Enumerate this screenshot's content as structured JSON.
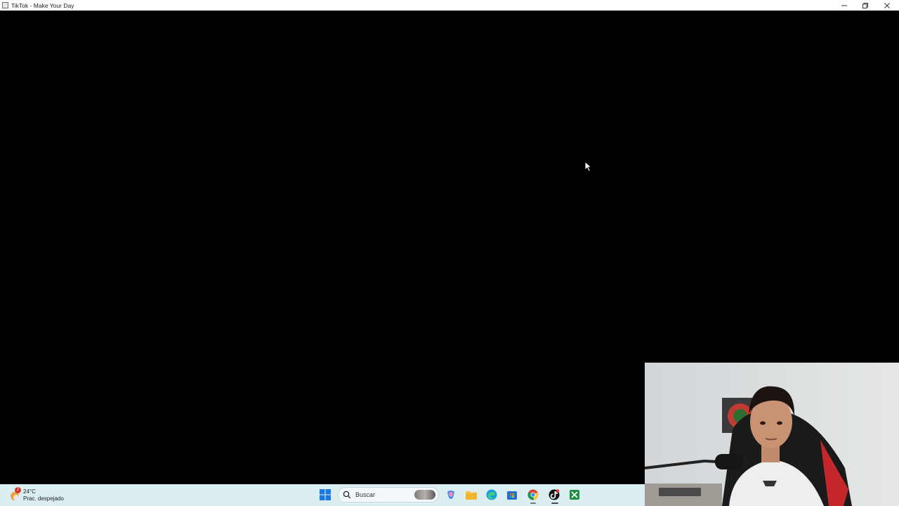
{
  "window": {
    "title": "TikTok - Make Your Day"
  },
  "taskbar": {
    "weather": {
      "temperature": "24°C",
      "description": "Prac. despejado",
      "badge": "2"
    },
    "search": {
      "placeholder": "Buscar"
    },
    "icons": [
      "windows-start-icon",
      "search-icon",
      "copilot-icon",
      "file-explorer-icon",
      "edge-icon",
      "microsoft-store-icon",
      "chrome-icon",
      "tiktok-icon",
      "xbox-icon"
    ]
  },
  "colors": {
    "taskbar_bg": "#dbeef1",
    "window_bg": "#000000",
    "titlebar_bg": "#ffffff"
  }
}
